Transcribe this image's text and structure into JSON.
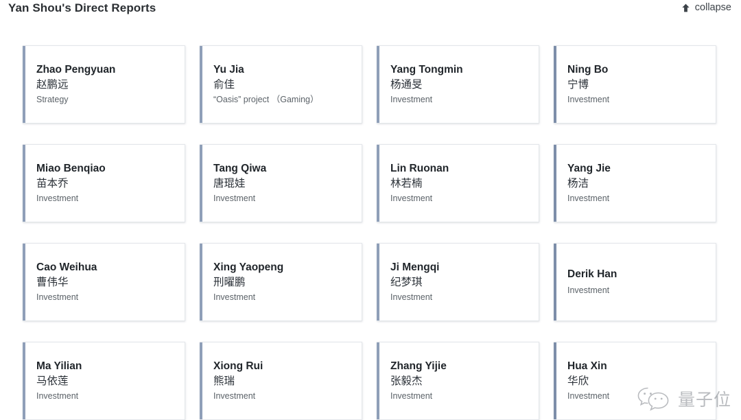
{
  "header": {
    "title": "Yan Shou's Direct Reports",
    "collapse_label": "collapse",
    "collapse_icon": "arrow-up-icon"
  },
  "accent_color": "#8f9fb8",
  "card_border_color": "#e3e6ea",
  "cards": [
    {
      "name_en": "Zhao Pengyuan",
      "name_cn": "赵鹏远",
      "role": "Strategy"
    },
    {
      "name_en": "Yu Jia",
      "name_cn": "俞佳",
      "role": "“Oasis” project （Gaming）"
    },
    {
      "name_en": "Yang Tongmin",
      "name_cn": "杨通旻",
      "role": "Investment"
    },
    {
      "name_en": "Ning Bo",
      "name_cn": "宁博",
      "role": "Investment"
    },
    {
      "name_en": "Miao Benqiao",
      "name_cn": "苗本乔",
      "role": "Investment"
    },
    {
      "name_en": "Tang Qiwa",
      "name_cn": "唐琨娃",
      "role": "Investment"
    },
    {
      "name_en": "Lin Ruonan",
      "name_cn": "林若楠",
      "role": "Investment"
    },
    {
      "name_en": "Yang Jie",
      "name_cn": "杨洁",
      "role": "Investment"
    },
    {
      "name_en": "Cao Weihua",
      "name_cn": "曹伟华",
      "role": "Investment"
    },
    {
      "name_en": "Xing Yaopeng",
      "name_cn": "刑曜鹏",
      "role": "Investment"
    },
    {
      "name_en": "Ji Mengqi",
      "name_cn": "纪梦琪",
      "role": "Investment"
    },
    {
      "name_en": "Derik Han",
      "name_cn": "",
      "role": "Investment"
    },
    {
      "name_en": "Ma Yilian",
      "name_cn": "马依莲",
      "role": "Investment"
    },
    {
      "name_en": "Xiong Rui",
      "name_cn": "熊瑞",
      "role": "Investment"
    },
    {
      "name_en": "Zhang Yijie",
      "name_cn": "张毅杰",
      "role": "Investment"
    },
    {
      "name_en": "Hua Xin",
      "name_cn": "华欣",
      "role": "Investment"
    }
  ],
  "watermark": {
    "text": "量子位",
    "logo": "wechat-bubbles-icon"
  }
}
